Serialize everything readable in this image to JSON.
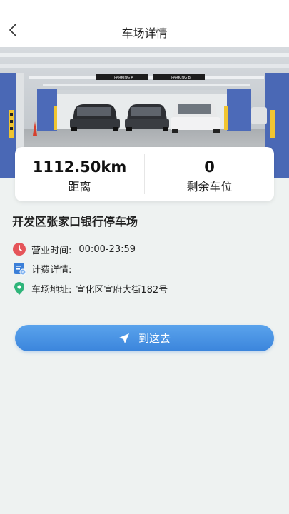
{
  "header": {
    "title": "车场详情"
  },
  "parking_photo": {
    "signs": [
      "PARKING A",
      "PARKING B"
    ]
  },
  "stats": {
    "distance_value": "1112.50km",
    "distance_label": "距离",
    "spaces_value": "0",
    "spaces_label": "剩余车位"
  },
  "lot": {
    "name": "开发区张家口银行停车场",
    "hours_label": "营业时间:",
    "hours_value": "00:00-23:59",
    "fee_label": "计费详情:",
    "address_label": "车场地址:",
    "address_value": "宣化区宣府大街182号"
  },
  "actions": {
    "go_label": "到这去"
  },
  "colors": {
    "accent": "#3b85dc",
    "clock_icon": "#e5555a",
    "fee_icon": "#3b7fd8",
    "location_icon": "#2fb57a",
    "background": "#eef2f1"
  },
  "icons": {
    "back": "chevron-left-icon",
    "hours": "clock-icon",
    "fee": "bill-icon",
    "address": "location-pin-icon",
    "navigate": "navigation-arrow-icon"
  }
}
